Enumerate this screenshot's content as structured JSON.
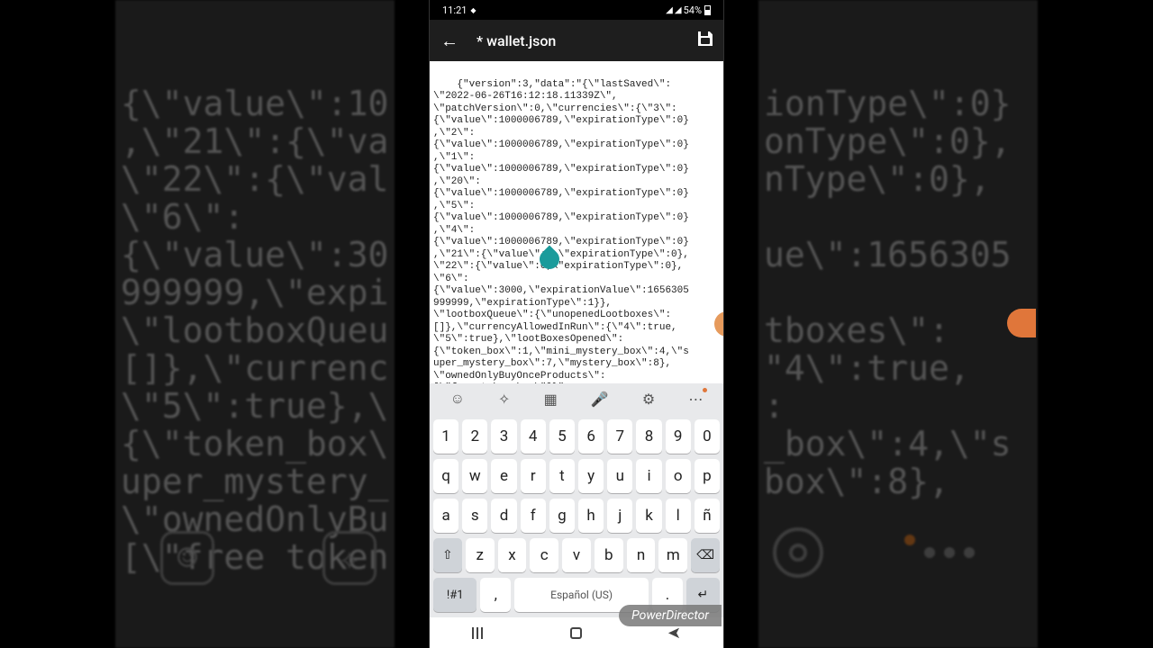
{
  "status": {
    "time": "11:21",
    "battery": "54%",
    "wifi_indicator": "▲",
    "net": "ıllıl"
  },
  "appbar": {
    "title": "* wallet.json",
    "back_glyph": "←"
  },
  "editor_text": "{\"version\":3,\"data\":\"{\\\"lastSaved\\\":\n\\\"2022-06-26T16:12:18.11339Z\\\",\n\\\"patchVersion\\\":0,\\\"currencies\\\":{\\\"3\\\":\n{\\\"value\\\":1000006789,\\\"expirationType\\\":0}\n,\\\"2\\\":\n{\\\"value\\\":1000006789,\\\"expirationType\\\":0}\n,\\\"1\\\":\n{\\\"value\\\":1000006789,\\\"expirationType\\\":0}\n,\\\"20\\\":\n{\\\"value\\\":1000006789,\\\"expirationType\\\":0}\n,\\\"5\\\":\n{\\\"value\\\":1000006789,\\\"expirationType\\\":0}\n,\\\"4\\\":\n{\\\"value\\\":1000006789,\\\"expirationType\\\":0}\n,\\\"21\\\":{\\\"value\\\":1,\\\"expirationType\\\":0},\n\\\"22\\\":{\\\"value\\\":0,\\\"expirationType\\\":0},\n\\\"6\\\":\n{\\\"value\\\":3000,\\\"expirationValue\\\":1656305\n999999,\\\"expirationType\\\":1}},\n\\\"lootboxQueue\\\":{\\\"unopenedLootboxes\\\":\n[]},\\\"currencyAllowedInRun\\\":{\\\"4\\\":true,\n\\\"5\\\":true},\\\"lootBoxesOpened\\\":\n{\\\"token_box\\\":1,\\\"mini_mystery_box\\\":4,\\\"s\nuper_mystery_box\\\":7,\\\"mystery_box\\\":8},\n\\\"ownedOnlyBuyOnceProducts\\\":\n[\\\"free_token_box\\\"]}\"",
  "keyboard": {
    "row_nums": [
      "1",
      "2",
      "3",
      "4",
      "5",
      "6",
      "7",
      "8",
      "9",
      "0"
    ],
    "row_top": [
      "q",
      "w",
      "e",
      "r",
      "t",
      "y",
      "u",
      "i",
      "o",
      "p"
    ],
    "row_mid": [
      "a",
      "s",
      "d",
      "f",
      "g",
      "h",
      "j",
      "k",
      "l",
      "ñ"
    ],
    "row_bot": [
      "⇧",
      "z",
      "x",
      "c",
      "v",
      "b",
      "n",
      "m",
      "⌫"
    ],
    "sym": "!#1",
    "comma": ",",
    "space": "Español (US)",
    "period": ".",
    "enter": "↵"
  },
  "toolbar_icons": {
    "emoji": "☺",
    "sticker": "✧",
    "clipboard": "▦",
    "mic": "🎤",
    "settings": "⚙",
    "more": "⋯"
  },
  "watermark": "PowerDirector",
  "bg_left_text": "{\\\"value\\\":10\n,\\\"21\\\":{\\\"va\n\\\"22\\\":{\\\"val\n\\\"6\\\":\n{\\\"value\\\":30\n999999,\\\"expi\n\\\"lootboxQueu\n[]},\\\"currenc\n\\\"5\\\":true},\\\n{\\\"token_box\\\nuper_mystery_\n\\\"ownedOnlyBu\n[\\\"free token",
  "bg_right_text": "ionType\\\":0}\nonType\\\":0},\nnType\\\":0},\n\nue\\\":1656305\n\ntboxes\\\":\n\"4\\\":true,\n:\n_box\\\":4,\\\"s\nbox\\\":8},\n"
}
